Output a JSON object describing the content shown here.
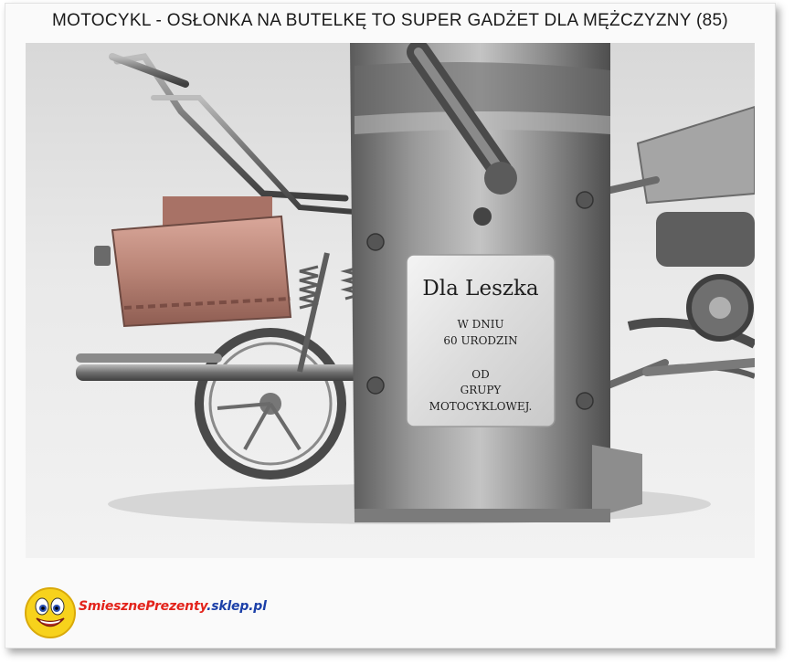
{
  "header": {
    "title": "MOTOCYKL - OSŁONKA NA BUTELKĘ TO SUPER GADŻET DLA MĘŻCZYZNY (85)"
  },
  "photo": {
    "plate": {
      "name": "Dla Leszka",
      "line1": "W DNIU",
      "line2": "60 URODZIN",
      "line3": "OD",
      "line4": "GRUPY",
      "line5": "MOTOCYKLOWEJ."
    }
  },
  "footer": {
    "logo_part1": "SmiesznePrezenty",
    "logo_part2": ".sklep.pl",
    "colors": {
      "part1": "#e3231b",
      "part2": "#1b3fa8"
    }
  }
}
